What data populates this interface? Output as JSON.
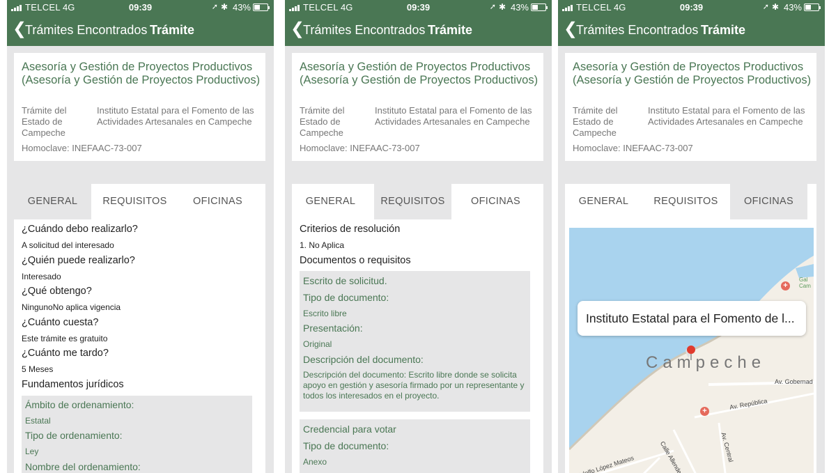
{
  "colors": {
    "header_green": "#4a7754",
    "label_green": "#4a7754",
    "background": "#e6e6e7",
    "map_water": "#a9d3ee",
    "map_land": "#f3efe7"
  },
  "status": {
    "carrier": "TELCEL",
    "network": "4G",
    "time": "09:39",
    "battery": "43%",
    "battery_level": 0.43
  },
  "nav": {
    "back_label": "Trámites Encontrados",
    "title": "Trámite",
    "back_icon": "chevron-left-icon"
  },
  "card": {
    "name": "Asesoría y Gestión de Proyectos Productivos (Asesoría y Gestión de Proyectos Productivos)",
    "type_label": "Trámite del Estado de Campeche",
    "institution": "Instituto Estatal para el Fomento de las Actividades Artesanales en Campeche",
    "homoclave": "Homoclave: INEFAAC-73-007"
  },
  "tabs": [
    "GENERAL",
    "REQUISITOS",
    "OFICINAS"
  ],
  "general": {
    "items": [
      {
        "q": "¿Cuándo debo realizarlo?",
        "a": "A solicitud del interesado"
      },
      {
        "q": "¿Quién puede realizarlo?",
        "a": "Interesado"
      },
      {
        "q": "¿Qué obtengo?",
        "a": "NingunoNo aplica vigencia"
      },
      {
        "q": "¿Cuánto cuesta?",
        "a": "Este trámite es gratuito"
      },
      {
        "q": "¿Cuánto me tardo?",
        "a": "5 Meses"
      }
    ],
    "fundamentos_title": "Fundamentos jurídicos",
    "fundamentos": [
      {
        "label": "Ámbito de ordenamiento:",
        "value": "Estatal"
      },
      {
        "label": "Tipo de ordenamiento:",
        "value": "Ley"
      },
      {
        "label": "Nombre del ordenamiento:",
        "value": ""
      }
    ]
  },
  "requisitos": {
    "criterios_title": "Criterios de resolución",
    "criterios_value": "1. No Aplica",
    "documentos_title": "Documentos o requisitos",
    "doc1": {
      "title": "Escrito de solicitud.",
      "tipo_label": "Tipo de documento:",
      "tipo_value": "Escrito libre",
      "presentacion_label": "Presentación:",
      "presentacion_value": "Original",
      "descripcion_label": "Descripción del documento:",
      "descripcion_value": " Descripción del documento: Escrito libre donde se solicita apoyo en gestión y asesoría firmado por un representante y todos los interesados en el proyecto."
    },
    "doc2": {
      "title": "Credencial para votar",
      "tipo_label": "Tipo de documento:",
      "tipo_value": "Anexo"
    }
  },
  "oficinas": {
    "callout": "Instituto Estatal para el Fomento de l...",
    "city": "Campeche",
    "streets": [
      "Av. Gobernad",
      "Av. República",
      "Av. Central",
      "Calle Allende",
      "Adolfo López Mateos"
    ],
    "poi": "Gal Cam"
  }
}
